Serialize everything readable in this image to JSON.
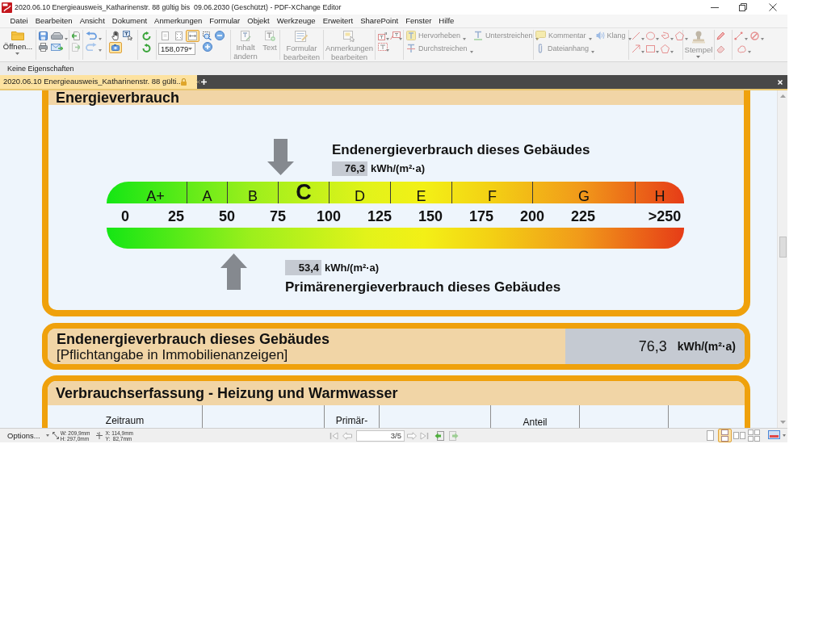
{
  "window": {
    "title": "2020.06.10 Energieausweis_Katharinenstr. 88 gültig bis  09.06.2030 (Geschützt) - PDF-XChange Editor"
  },
  "menu_bar": [
    "Datei",
    "Bearbeiten",
    "Ansicht",
    "Dokument",
    "Anmerkungen",
    "Formular",
    "Objekt",
    "Werkzeuge",
    "Erweitert",
    "SharePoint",
    "Fenster",
    "Hilfe"
  ],
  "toolbar": {
    "open_button": {
      "label": "Öffnen...",
      "disabled": false
    },
    "snapshot_button": {
      "selected": true
    },
    "fit_buttons": [
      {
        "selected": false
      },
      {
        "selected": false
      },
      {
        "selected": true
      }
    ],
    "zoom_field": {
      "value": "158,079"
    },
    "edit_buttons": [
      {
        "label": "Inhalt ändern",
        "disabled": true
      },
      {
        "label": "Text",
        "disabled": true
      },
      {
        "label": "Formular bearbeiten",
        "disabled": true
      },
      {
        "label": "Anmerkungen bearbeiten",
        "disabled": true
      }
    ],
    "markup_tools": [
      {
        "label": "Hervorheben",
        "disabled": true
      },
      {
        "label": "Unterstreichen",
        "disabled": true
      },
      {
        "label": "Durchstreichen",
        "disabled": true
      }
    ],
    "comment_tools": [
      {
        "label": "Kommentar",
        "disabled": true
      },
      {
        "label": "Klang",
        "disabled": true
      },
      {
        "label": "Dateianhang",
        "disabled": true
      }
    ],
    "stamp_button": {
      "label": "Stempel",
      "disabled": true
    }
  },
  "properties_bar": {
    "label": "Keine Eigenschaften"
  },
  "tabs": [
    {
      "label": "2020.06.10 Energieausweis_Katharinenstr. 88 gülti..",
      "selected": true
    }
  ],
  "document": {
    "energy_section": {
      "heading": "Energieverbrauch",
      "final_energy": {
        "title": "Endenergieverbrauch dieses Gebäudes",
        "value": "76,3",
        "unit": "kWh/(m²·a)",
        "level": 0.301
      },
      "classes": [
        {
          "label": "A+",
          "selected": false
        },
        {
          "label": "A",
          "selected": false
        },
        {
          "label": "B",
          "selected": false
        },
        {
          "label": "C",
          "selected": true
        },
        {
          "label": "D",
          "selected": false
        },
        {
          "label": "E",
          "selected": false
        },
        {
          "label": "F",
          "selected": false
        },
        {
          "label": "G",
          "selected": false
        },
        {
          "label": "H",
          "selected": false
        }
      ],
      "ticks": [
        "0",
        "25",
        "50",
        "75",
        "100",
        "125",
        "150",
        "175",
        "200",
        "225",
        ">250"
      ],
      "primary_energy": {
        "value": "53,4",
        "unit": "kWh/(m²·a)",
        "title": "Primärenergieverbrauch dieses Gebäudes",
        "level": 0.22
      }
    },
    "summary_box": {
      "title": "Endenergieverbrauch dieses Gebäudes",
      "note": "[Pflichtangabe in Immobilienanzeigen]",
      "value": "76,3",
      "unit": "kWh/(m²·a)"
    },
    "consumption_section": {
      "heading": "Verbrauchserfassung - Heizung und Warmwasser",
      "columns": [
        "Zeitraum",
        "Primär-",
        "Anteil"
      ]
    }
  },
  "status_bar": {
    "options_button": "Options...",
    "page_size": {
      "width": "W: 209,9mm",
      "height": "H: 297,0mm"
    },
    "cursor_position": {
      "x": "X: 114,9mm",
      "y": "Y:  82,7mm"
    },
    "page_field": {
      "value": "3/5"
    },
    "view_modes": [
      {
        "selected": false
      },
      {
        "selected": true
      },
      {
        "selected": false
      },
      {
        "selected": false
      }
    ]
  }
}
